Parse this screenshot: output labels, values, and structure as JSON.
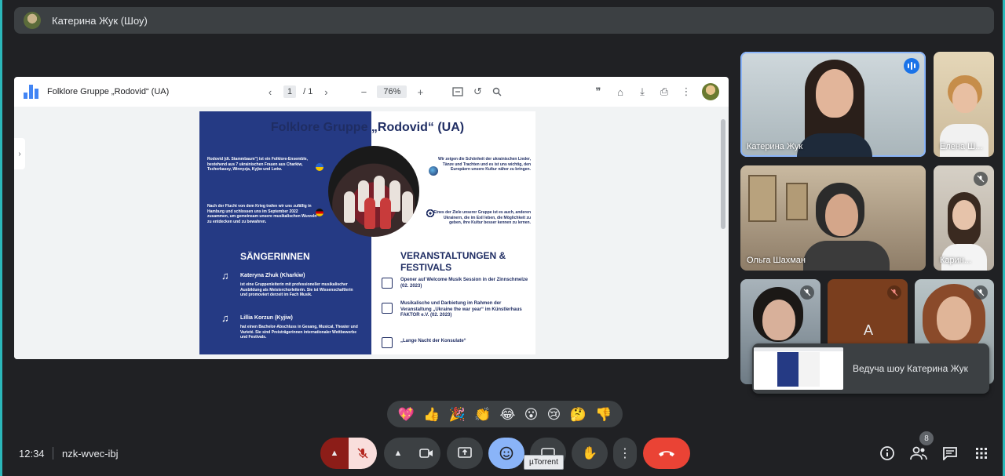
{
  "presenter_bar": {
    "title": "Катерина Жук (Шоу)"
  },
  "pdf": {
    "title": "Folklore Gruppe „Rodovid“ (UA)",
    "page_current": "1",
    "page_total": "/ 1",
    "zoom": "76%"
  },
  "flyer": {
    "title": "Folklore Gruppe „Rodovid“ (UA)",
    "intro": "Rodovid (dt. Stammbaum\") ist ein Folklore-Ensemble, bestehend aus 7 ukrainischen Frauen aus Charkiw, Tscherkassy, Winnyzja, Kyjiw und Lwiw.",
    "flight": "Nach der Flucht von dem Krieg trafen wir uns zufällig in Hamburg und schlossen uns im September 2022 zusammen, um gemeinsam unsere musikalischen Wurzeln zu entdecken und zu bewahren.",
    "beauty": "Wir zeigen die Schönheit der ukrainischen Lieder, Tänze und Trachten und es ist uns wichtig, den Europäern unsere Kultur näher zu bringen.",
    "goal": "Eines der Ziele unserer Gruppe ist es auch, anderen Ukrainern, die im Exil leben, die Möglichkeit zu geben, ihre Kultur besser kennen zu lernen.",
    "singers_heading": "SÄNGERINNEN",
    "singer1_name": "Kateryna Zhuk (Kharkiw)",
    "singer1_text": "ist eine Gruppenleiterin mit professioneller musikalischer Ausbildung als Meisterchorleiterin. Sie ist Wissenschaftlerin und promoviert derzeit im Fach Musik.",
    "singer2_name": "Lillia Korzun (Kyjiw)",
    "singer2_text": "hat einen Bachelor-Abschluss in Gesang, Musical, Theater und Varieté. Sie sind Preisträgerinnen internationaler Wettbewerbe und Festivals.",
    "events_heading": "VERANSTALTUNGEN & FESTIVALS",
    "event1": "Opener auf Welcome Musik Session in der Zinnschmelze (02. 2023)",
    "event2": "Musikalische und Darbietung im Rahmen der Veranstaltung „Ukraine the war year“ im Künstlerhaus FAKTOR e.V. (02. 2023)",
    "event3": "„Lange Nacht der Konsulate“"
  },
  "participants": [
    {
      "name": "Катерина Жук",
      "speaking": true
    },
    {
      "name": "Елена Ш...",
      "muted": false
    },
    {
      "name": "Ольга Шахман",
      "muted": false
    },
    {
      "name": "Карин...",
      "muted": true
    },
    {
      "name": "",
      "muted": true
    },
    {
      "name": "A",
      "muted": true
    },
    {
      "name": "",
      "muted": true
    }
  ],
  "preview": {
    "label": "Ведуча шоу Катерина Жук"
  },
  "reactions": [
    "💖",
    "👍",
    "🎉",
    "👏",
    "😂",
    "😮",
    "😢",
    "🤔",
    "👎"
  ],
  "bottom": {
    "time": "12:34",
    "meeting_code": "nzk-wvec-ibj",
    "people_count": "8",
    "tooltip": "µTorrent"
  },
  "colors": {
    "background": "#202124",
    "panel": "#3c4043",
    "hangup": "#ea4335",
    "active_blue": "#8ab4f8",
    "flyer_blue": "#253a84"
  }
}
